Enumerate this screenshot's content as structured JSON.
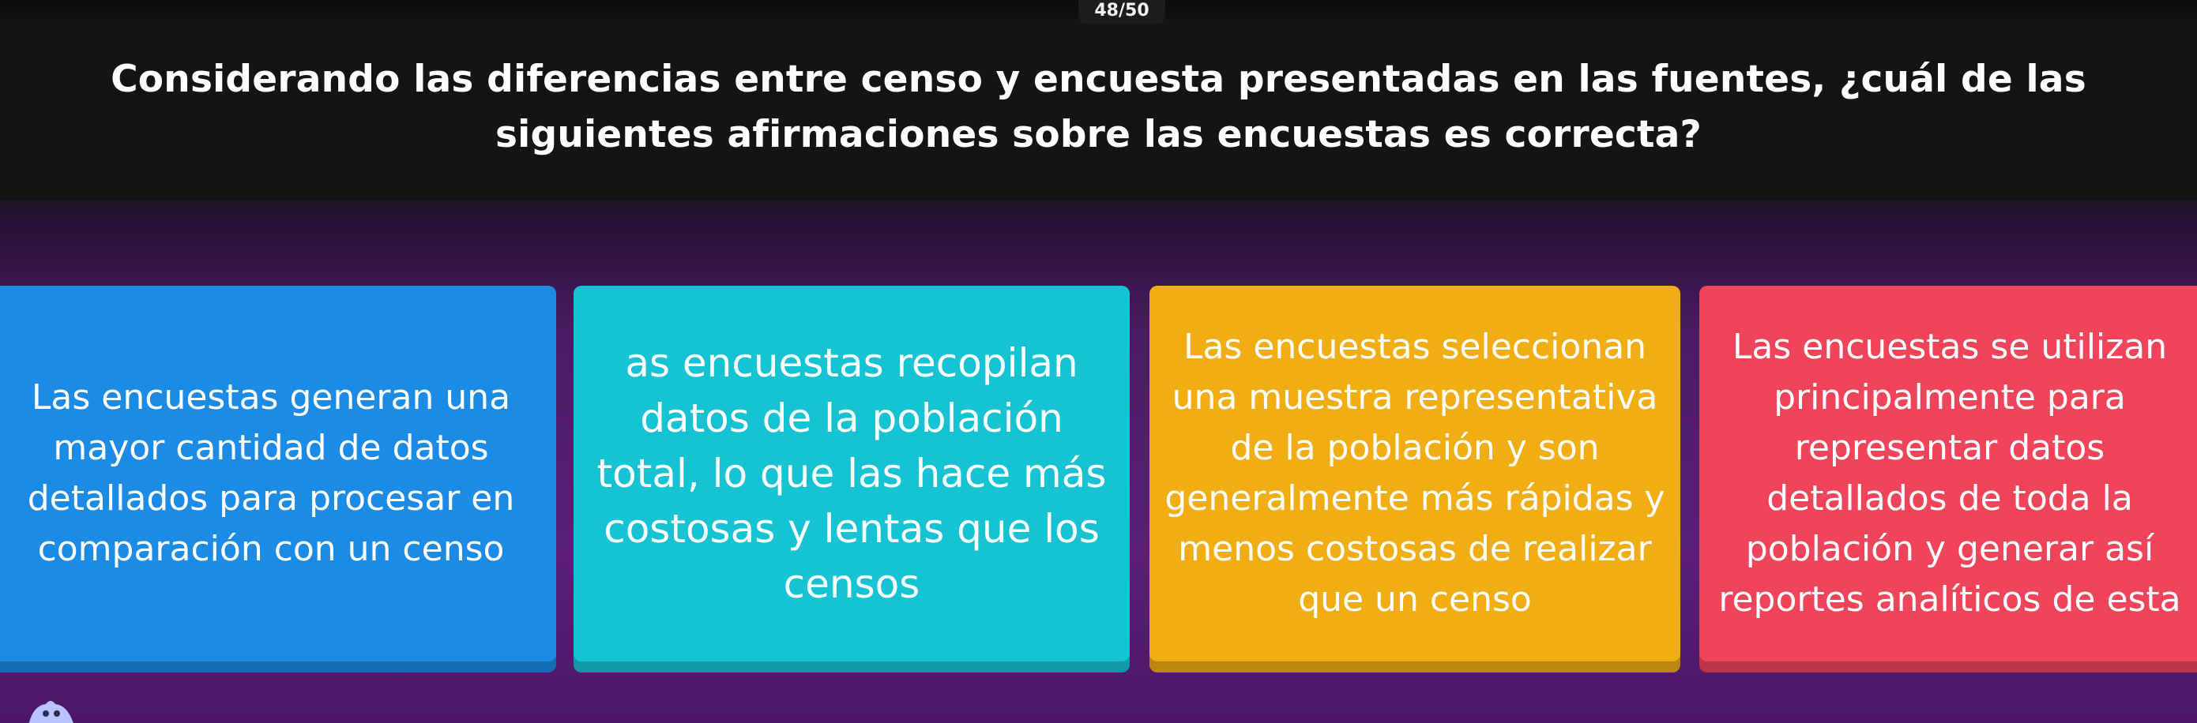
{
  "header": {
    "counter": "48/50"
  },
  "question": {
    "text": "Considerando las diferencias entre censo y encuesta presentadas en las fuentes, ¿cuál de las siguientes afirmaciones sobre las encuestas es correcta?"
  },
  "options": [
    {
      "text": "Las encuestas generan una mayor cantidad de datos detallados para procesar en comparación con un censo",
      "color": "#1c8be6"
    },
    {
      "text": "as encuestas recopilan datos de la población total, lo que las hace más costosas y lentas que los censos",
      "color": "#16c3d3"
    },
    {
      "text": "Las encuestas seleccionan una muestra representativa de la población y son generalmente más rápidas y menos costosas de realizar que un censo",
      "color": "#f0ad14"
    },
    {
      "text": "Las encuestas se utilizan principalmente para representar datos detallados de toda la población y generar así reportes analíticos de esta",
      "color": "#f0445a"
    }
  ],
  "colors": {
    "background_top": "#141416",
    "background_bottom": "#5b1f7a"
  }
}
